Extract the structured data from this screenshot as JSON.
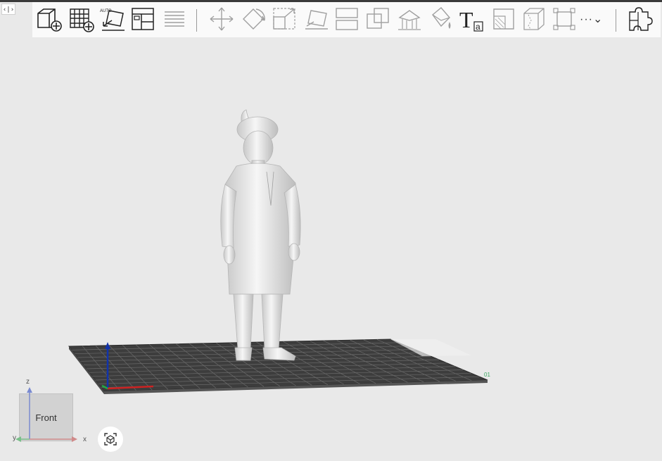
{
  "topbar": {
    "collapse_label": "‹|›"
  },
  "toolbar": {
    "items": [
      {
        "name": "add-object-button",
        "icon": "cube-plus-icon",
        "enabled": true
      },
      {
        "name": "add-grid-button",
        "icon": "grid-plus-icon",
        "enabled": true
      },
      {
        "name": "auto-arrange-button",
        "icon": "auto-arrange-icon",
        "label": "AUTO",
        "enabled": true
      },
      {
        "name": "layout-button",
        "icon": "layout-icon",
        "enabled": true
      },
      {
        "name": "layers-button",
        "icon": "layers-icon",
        "enabled": false
      },
      {
        "name": "move-button",
        "icon": "move-icon",
        "enabled": false
      },
      {
        "name": "rotate-button",
        "icon": "rotate-icon",
        "enabled": false
      },
      {
        "name": "scale-button",
        "icon": "scale-icon",
        "enabled": false
      },
      {
        "name": "lay-flat-button",
        "icon": "lay-flat-icon",
        "enabled": false
      },
      {
        "name": "split-button",
        "icon": "split-icon",
        "enabled": false
      },
      {
        "name": "boolean-button",
        "icon": "boolean-icon",
        "enabled": false
      },
      {
        "name": "support-button",
        "icon": "support-icon",
        "enabled": false
      },
      {
        "name": "paint-button",
        "icon": "paint-bucket-icon",
        "enabled": false
      },
      {
        "name": "text-button",
        "icon": "text-icon",
        "label_main": "T",
        "label_sub": "a",
        "enabled": true
      },
      {
        "name": "hollow-button",
        "icon": "hollow-icon",
        "enabled": false
      },
      {
        "name": "cut-button",
        "icon": "cut-icon",
        "enabled": false
      },
      {
        "name": "measure-button",
        "icon": "measure-icon",
        "enabled": false
      },
      {
        "name": "more-button",
        "icon": "chevron-down-icon",
        "label": "···⌄",
        "enabled": true
      },
      {
        "name": "plugins-button",
        "icon": "puzzle-icon",
        "enabled": true
      }
    ]
  },
  "viewcube": {
    "face_label": "Front",
    "axis_z": "z",
    "axis_x": "x",
    "axis_y": "y"
  },
  "plate": {
    "label": "01"
  },
  "colors": {
    "background": "#e9e9e9",
    "toolbar": "#fafafa",
    "plate": "#3d3d3d",
    "axis_x": "#cc2222",
    "axis_y": "#22aa44",
    "axis_z": "#1133aa"
  }
}
